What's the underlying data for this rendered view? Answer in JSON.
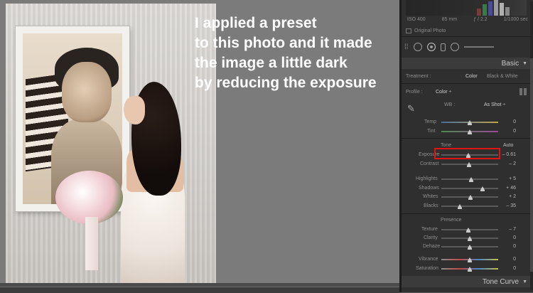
{
  "caption": {
    "lines": [
      "I applied a preset",
      "to this photo and it made",
      "the image a little dark",
      "by reducing the exposure"
    ]
  },
  "panel": {
    "exif": {
      "iso": "ISO 400",
      "focal": "85 mm",
      "aperture": "ƒ / 2.2",
      "shutter": "1/1000 sec"
    },
    "original_photo": "Original Photo",
    "basic_title": "Basic",
    "treatment": {
      "label": "Treatment :",
      "color": "Color",
      "bw": "Black & White"
    },
    "profile": {
      "label": "Profile :",
      "value": "Color ÷"
    },
    "wb": {
      "label": "WB :",
      "value": "As Shot ÷"
    },
    "temp": {
      "label": "Temp",
      "value": "0",
      "level": 0.5
    },
    "tint": {
      "label": "Tint",
      "value": "0",
      "level": 0.5
    },
    "tone": {
      "label": "Tone",
      "auto": "Auto"
    },
    "exposure": {
      "label": "Exposure",
      "value": "– 0.61",
      "level": 0.47
    },
    "contrast": {
      "label": "Contrast",
      "value": "– 2",
      "level": 0.49
    },
    "highlights": {
      "label": "Highlights",
      "value": "+ 5",
      "level": 0.52
    },
    "shadows": {
      "label": "Shadows",
      "value": "+ 46",
      "level": 0.72
    },
    "whites": {
      "label": "Whites",
      "value": "+ 2",
      "level": 0.51
    },
    "blacks": {
      "label": "Blacks",
      "value": "– 35",
      "level": 0.33
    },
    "presence": {
      "label": "Presence"
    },
    "texture": {
      "label": "Texture",
      "value": "– 7",
      "level": 0.47
    },
    "clarity": {
      "label": "Clarity",
      "value": "0",
      "level": 0.5
    },
    "dehaze": {
      "label": "Dehaze",
      "value": "0",
      "level": 0.5
    },
    "vibrance": {
      "label": "Vibrance",
      "value": "0",
      "level": 0.5
    },
    "saturation": {
      "label": "Saturation",
      "value": "0",
      "level": 0.5
    },
    "tone_curve_title": "Tone Curve"
  },
  "colors": {
    "highlight_box": "#e01414",
    "caption": "#ffffff"
  },
  "icons": [
    "eyedropper-icon",
    "crop-icon",
    "spot-removal-icon",
    "red-eye-icon",
    "graduated-filter-icon",
    "radial-filter-icon",
    "adjustment-brush-icon",
    "grid-icon",
    "collapse-triangle-icon"
  ]
}
